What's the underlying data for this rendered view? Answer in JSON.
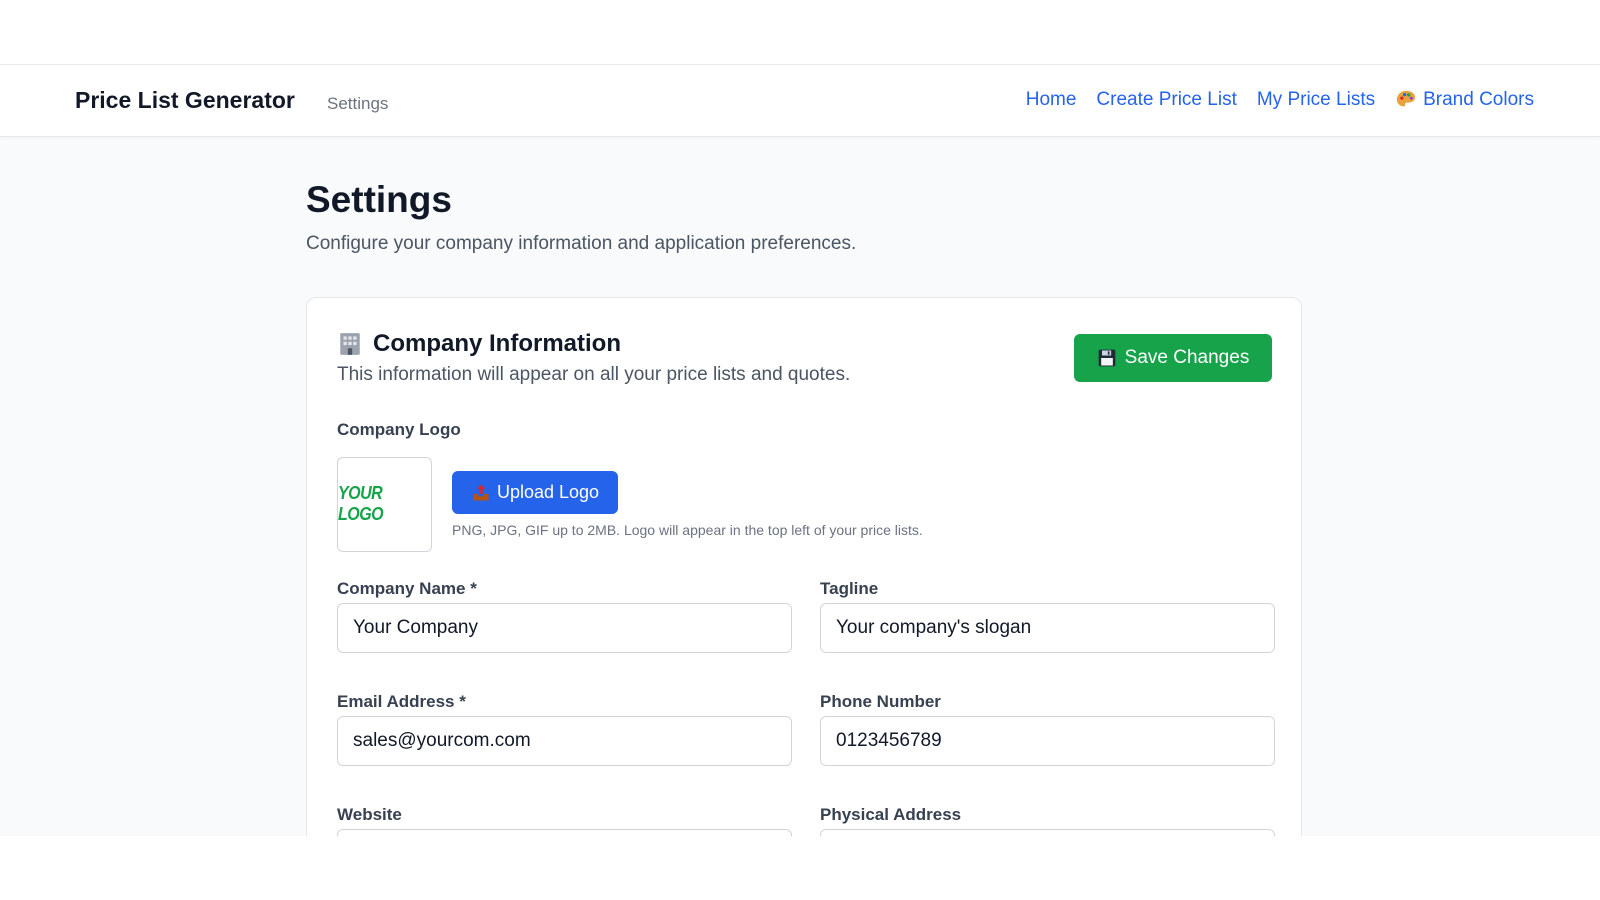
{
  "nav": {
    "brand": "Price List Generator",
    "crumb": "Settings",
    "links": [
      {
        "label": "Home"
      },
      {
        "label": "Create Price List"
      },
      {
        "label": "My Price Lists"
      },
      {
        "label": "Brand Colors",
        "icon": "palette-icon"
      }
    ]
  },
  "page": {
    "title": "Settings",
    "subtitle": "Configure your company information and application preferences."
  },
  "company": {
    "icon": "building-icon",
    "title": "Company Information",
    "desc": "This information will appear on all your price lists and quotes.",
    "save_label": "Save Changes",
    "save_icon": "floppy-disk-icon",
    "logo_label": "Company Logo",
    "logo_text": "YOUR LOGO",
    "upload_label": "Upload Logo",
    "upload_icon": "outbox-tray-icon",
    "upload_hint": "PNG, JPG, GIF up to 2MB. Logo will appear in the top left of your price lists.",
    "fields": {
      "name_label": "Company Name *",
      "name_value": "Your Company",
      "tagline_label": "Tagline",
      "tagline_value": "Your company's slogan",
      "email_label": "Email Address *",
      "email_value": "sales@yourcom.com",
      "phone_label": "Phone Number",
      "phone_value": "0123456789",
      "website_label": "Website",
      "address_label": "Physical Address"
    }
  },
  "colors": {
    "accent": "#2563eb",
    "save_green": "#16a34a",
    "logo_green": "#16a34a"
  }
}
